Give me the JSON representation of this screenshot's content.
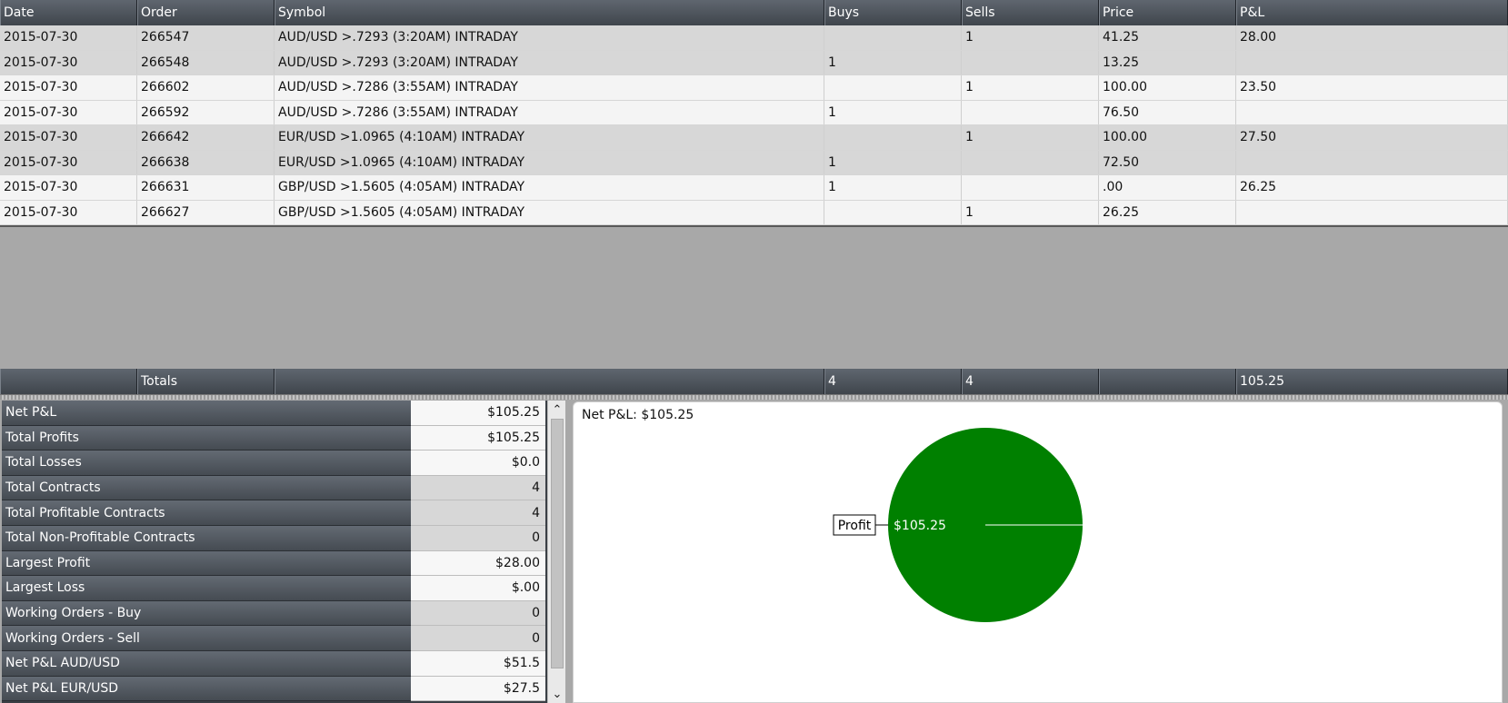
{
  "grid": {
    "columns": [
      "Date",
      "Order",
      "Symbol",
      "Buys",
      "Sells",
      "Price",
      "P&L"
    ],
    "rows": [
      {
        "date": "2015-07-30",
        "order": "266547",
        "symbol": "AUD/USD >.7293 (3:20AM) INTRADAY",
        "buys": "",
        "sells": "1",
        "price": "41.25",
        "pl": "28.00"
      },
      {
        "date": "2015-07-30",
        "order": "266548",
        "symbol": "AUD/USD >.7293 (3:20AM) INTRADAY",
        "buys": "1",
        "sells": "",
        "price": "13.25",
        "pl": ""
      },
      {
        "date": "2015-07-30",
        "order": "266602",
        "symbol": "AUD/USD >.7286 (3:55AM) INTRADAY",
        "buys": "",
        "sells": "1",
        "price": "100.00",
        "pl": "23.50"
      },
      {
        "date": "2015-07-30",
        "order": "266592",
        "symbol": "AUD/USD >.7286 (3:55AM) INTRADAY",
        "buys": "1",
        "sells": "",
        "price": "76.50",
        "pl": ""
      },
      {
        "date": "2015-07-30",
        "order": "266642",
        "symbol": "EUR/USD >1.0965 (4:10AM) INTRADAY",
        "buys": "",
        "sells": "1",
        "price": "100.00",
        "pl": "27.50"
      },
      {
        "date": "2015-07-30",
        "order": "266638",
        "symbol": "EUR/USD >1.0965 (4:10AM) INTRADAY",
        "buys": "1",
        "sells": "",
        "price": "72.50",
        "pl": ""
      },
      {
        "date": "2015-07-30",
        "order": "266631",
        "symbol": "GBP/USD >1.5605 (4:05AM) INTRADAY",
        "buys": "1",
        "sells": "",
        "price": ".00",
        "pl": "26.25"
      },
      {
        "date": "2015-07-30",
        "order": "266627",
        "symbol": "GBP/USD >1.5605 (4:05AM) INTRADAY",
        "buys": "",
        "sells": "1",
        "price": "26.25",
        "pl": ""
      }
    ],
    "totals": {
      "label": "Totals",
      "buys": "4",
      "sells": "4",
      "pl": "105.25"
    }
  },
  "stats": [
    {
      "label": "Net P&L",
      "value": "$105.25"
    },
    {
      "label": "Total Profits",
      "value": "$105.25"
    },
    {
      "label": "Total Losses",
      "value": "$0.0"
    },
    {
      "label": "Total Contracts",
      "value": "4"
    },
    {
      "label": "Total Profitable Contracts",
      "value": "4"
    },
    {
      "label": "Total Non-Profitable Contracts",
      "value": "0"
    },
    {
      "label": "Largest Profit",
      "value": "$28.00"
    },
    {
      "label": "Largest Loss",
      "value": "$.00"
    },
    {
      "label": "Working Orders - Buy",
      "value": "0"
    },
    {
      "label": "Working Orders - Sell",
      "value": "0"
    },
    {
      "label": "Net P&L AUD/USD",
      "value": "$51.5"
    },
    {
      "label": "Net P&L EUR/USD",
      "value": "$27.5"
    }
  ],
  "scrollbar": {
    "up_icon": "chevron-up-icon",
    "down_icon": "chevron-down-icon"
  },
  "chart_data": {
    "type": "pie",
    "title": "Net P&L: $105.25",
    "slices": [
      {
        "label": "Profit",
        "value": 105.25,
        "value_label": "$105.25",
        "color": "#008000"
      }
    ]
  }
}
